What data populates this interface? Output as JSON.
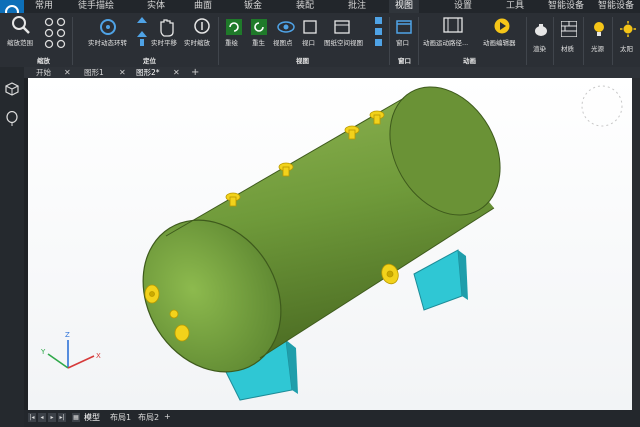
{
  "ribbon_tabs": [
    "常用",
    "徒手描绘",
    "实体",
    "曲面",
    "钣金",
    "装配",
    "批注",
    "视图",
    "设置",
    "工具",
    "智能设备",
    "智能设备"
  ],
  "active_tab": "视图",
  "toolbar": {
    "zoom_extents": "缩放范围",
    "realtime_orbit": "实时动态环转",
    "realtime_pan": "实时平移",
    "realtime_zoom": "实时缩放",
    "redraw": "重绘",
    "regen": "重生",
    "viewpoint": "视图点",
    "viewport": "视口",
    "drawing_space_view": "图纸空间视图",
    "window": "窗口",
    "animation_path": "动画运动路径...",
    "animation_editor": "动画编辑器",
    "render": "渲染",
    "material": "材质",
    "light": "光源",
    "sun": "太阳"
  },
  "groups": {
    "zoom": "缩放",
    "locate": "定位",
    "view": "视图",
    "window": "窗口",
    "animation": "动画"
  },
  "doc_tabs": [
    "开始",
    "图形1",
    "图形2*"
  ],
  "active_doc": "图形2*",
  "layout_tabs": [
    "模型",
    "布局1",
    "布局2"
  ],
  "axis_labels": {
    "x": "X",
    "y": "Y",
    "z": "Z"
  },
  "colors": {
    "tank": "#6f9a3a",
    "supports": "#2fc7d4",
    "flanges": "#f2d21b",
    "accent": "#0d6fb8"
  }
}
